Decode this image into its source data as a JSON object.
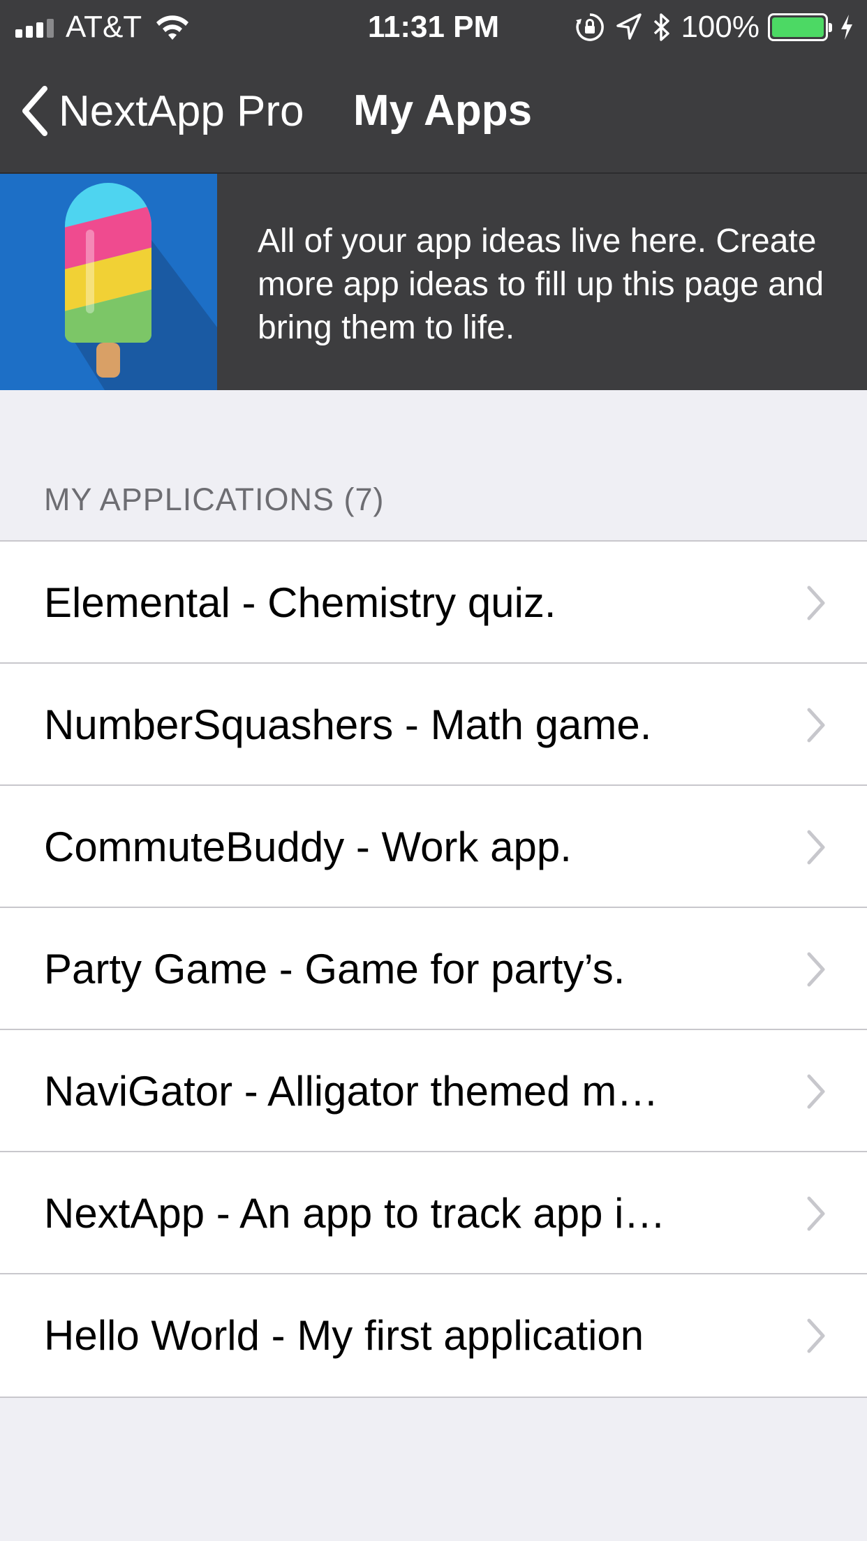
{
  "status_bar": {
    "carrier": "AT&T",
    "time": "11:31 PM",
    "battery_percent": "100%",
    "battery_color": "#4cd964"
  },
  "nav": {
    "back_label": "NextApp Pro",
    "title": "My Apps"
  },
  "banner": {
    "text": "All of your app ideas live here. Create more app ideas to fill up this page and bring them to life.",
    "icon": "popsicle-icon"
  },
  "section": {
    "header": "MY APPLICATIONS (7)"
  },
  "apps": [
    {
      "label": "Elemental - Chemistry quiz."
    },
    {
      "label": "NumberSquashers - Math game."
    },
    {
      "label": "CommuteBuddy - Work app."
    },
    {
      "label": "Party Game - Game for party’s."
    },
    {
      "label": "NaviGator - Alligator themed m…"
    },
    {
      "label": "NextApp - An app to track app i…"
    },
    {
      "label": "Hello World - My first application"
    }
  ],
  "colors": {
    "bar_background": "#3d3d3f",
    "banner_accent": "#1d6fc6",
    "page_background": "#efeff4",
    "separator": "#c8c7cc"
  }
}
